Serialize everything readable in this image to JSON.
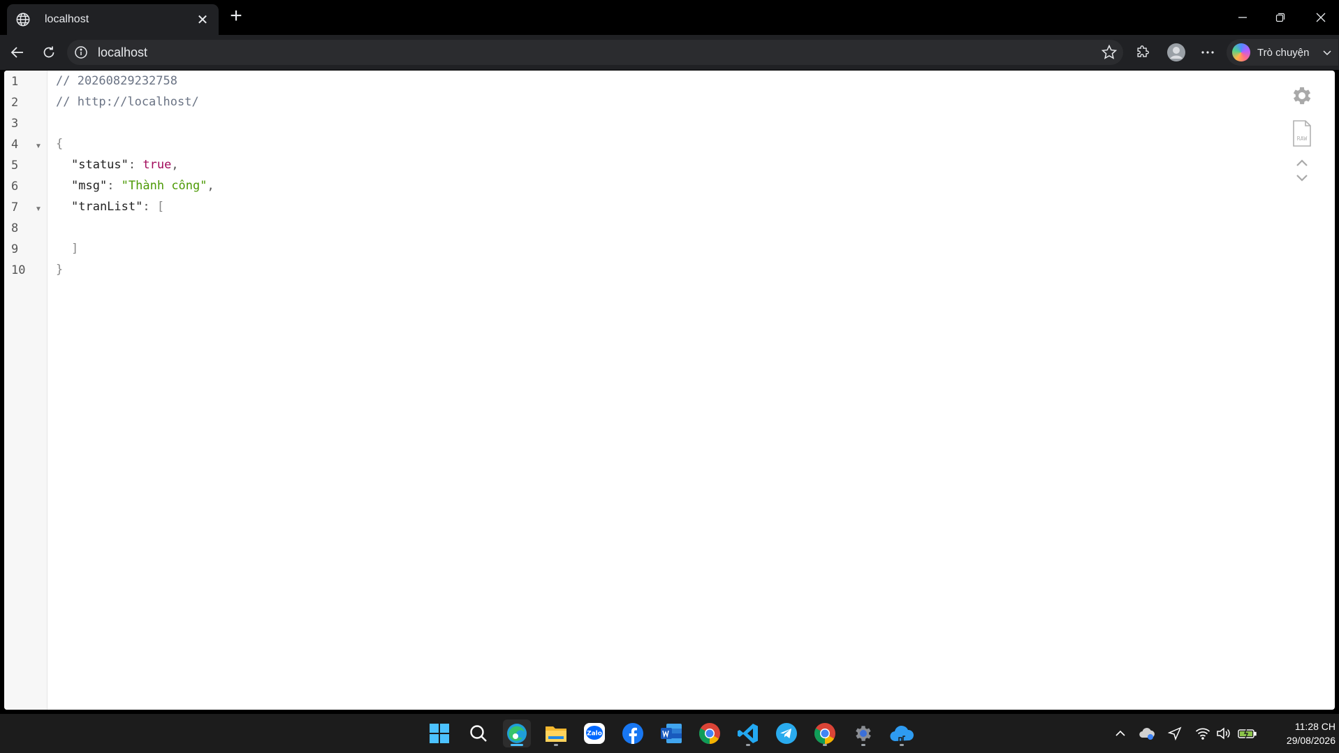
{
  "browser": {
    "tab_title": "localhost",
    "url": "localhost",
    "copilot_label": "Trò chuyện"
  },
  "editor": {
    "line_numbers": [
      "1",
      "2",
      "3",
      "4",
      "5",
      "6",
      "7",
      "8",
      "9",
      "10"
    ],
    "comment_timestamp": "// 20260829232758",
    "comment_url": "// http://localhost/",
    "open_brace": "{",
    "close_brace": "}",
    "status_key": "\"status\"",
    "status_value": "true",
    "msg_key": "\"msg\"",
    "msg_value": "\"Thành công\"",
    "tranlist_key": "\"tranList\"",
    "open_bracket": "[",
    "close_bracket": "]",
    "colon": ": ",
    "comma": ","
  },
  "side_tools": {
    "raw_label": "RAW"
  },
  "taskbar": {
    "time": "11:28 CH",
    "date": "29/08/2026",
    "zalo_label": "Zalo"
  }
}
